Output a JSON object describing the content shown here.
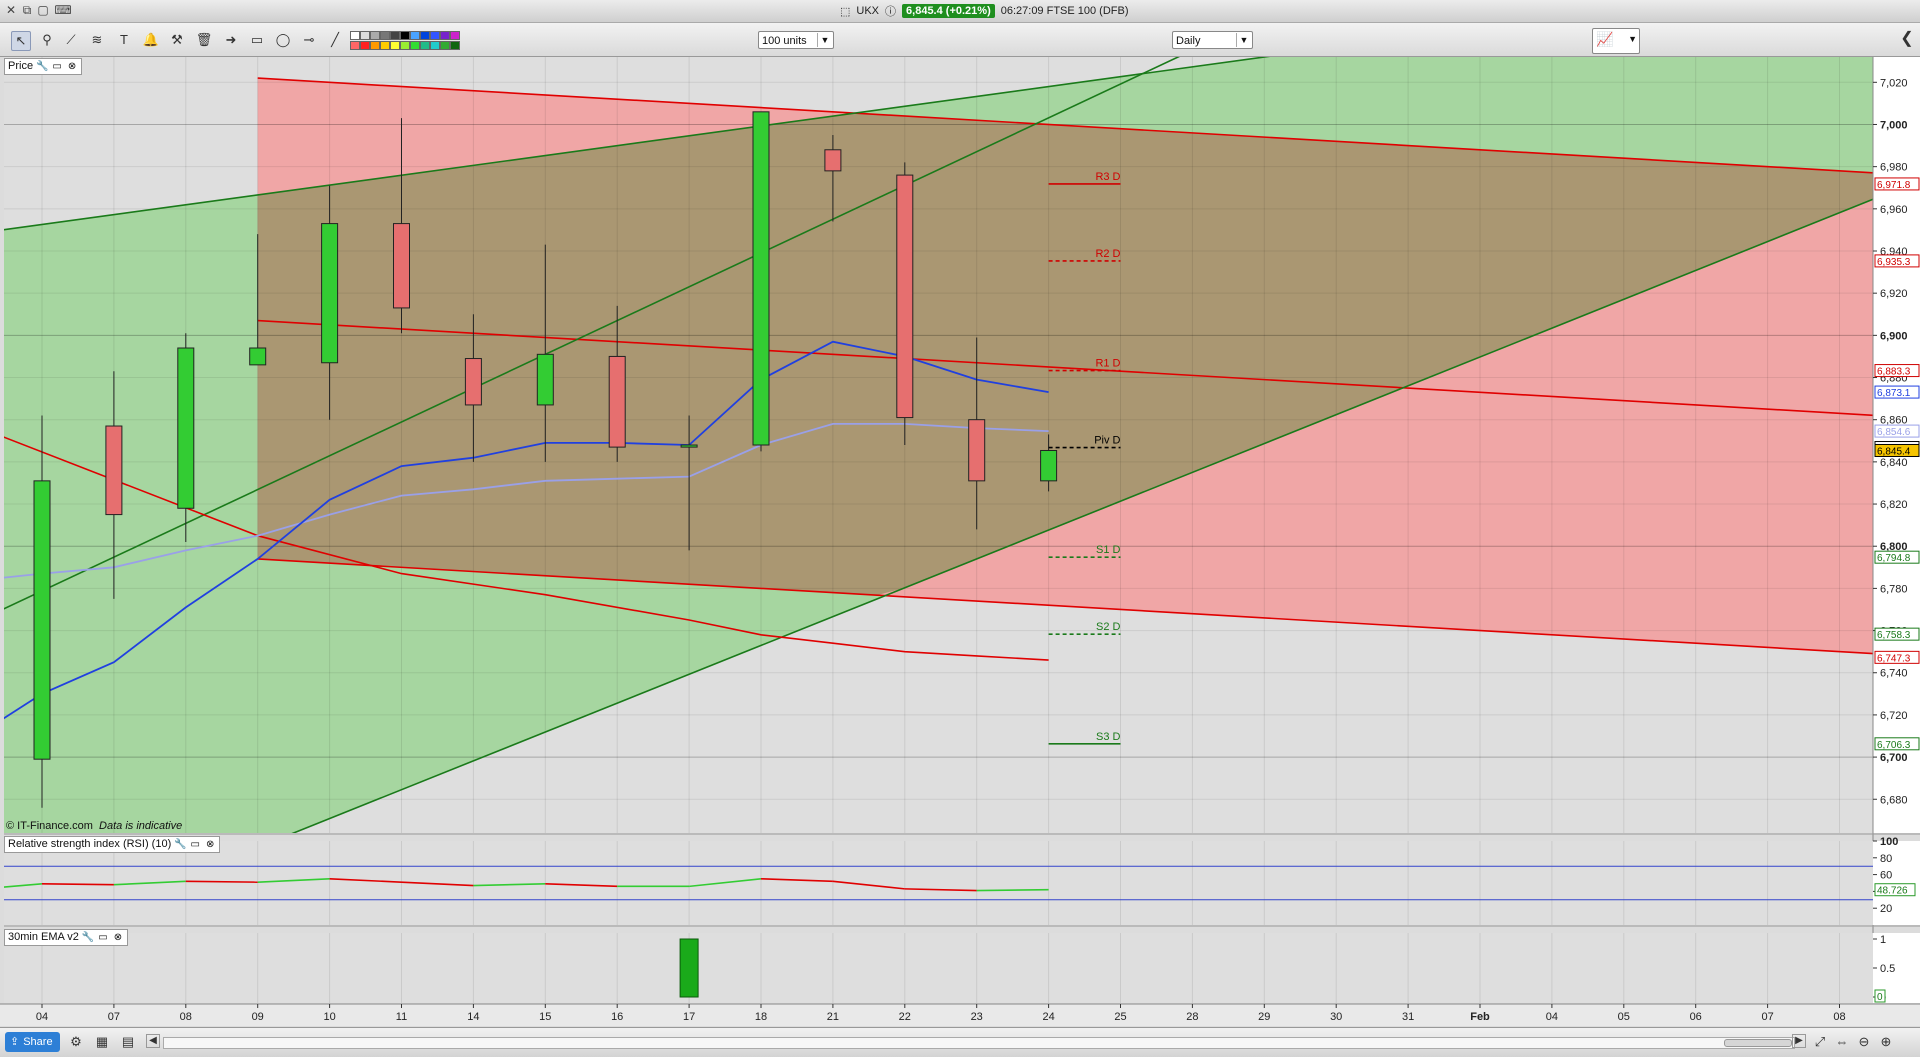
{
  "window": {
    "instrument": "UKX",
    "price_chip": "6,845.4 (+0.21%)",
    "status": "06:27:09 FTSE 100 (DFB)"
  },
  "toolbar": {
    "units_select": "100 units",
    "interval_select": "Daily"
  },
  "panels": {
    "price_label": "Price",
    "rsi_label": "Relative strength index (RSI) (10)",
    "ema_label": "30min EMA v2",
    "copyright": "© IT-Finance.com",
    "indicative": "Data is indicative"
  },
  "bottom": {
    "share_label": "Share"
  },
  "colors": {
    "up": "#33cc33",
    "down": "#e66f6f",
    "channel_red": "#e00000",
    "channel_green": "#1a7a1a",
    "ma_blue": "#2040e0",
    "ma_lavender": "#9aa0e8",
    "zone_green": "#a6d6a0",
    "zone_red": "#f0a6a6",
    "zone_brown": "#aa9772"
  },
  "chart_data": [
    {
      "type": "candlestick",
      "x_labels": [
        "04",
        "07",
        "08",
        "09",
        "10",
        "11",
        "14",
        "15",
        "16",
        "17",
        "18",
        "21",
        "22",
        "23",
        "24",
        "25",
        "28",
        "29",
        "30",
        "31",
        "Feb",
        "04",
        "05",
        "06",
        "07",
        "08"
      ],
      "y_ticks": [
        6680,
        6700,
        6720,
        6740,
        6760,
        6780,
        6800,
        6820,
        6840,
        6860,
        6880,
        6900,
        6920,
        6940,
        6960,
        6980,
        7000,
        7020
      ],
      "y_tick_labels": [
        "6,680",
        "6,700",
        "6,720",
        "6,740",
        "6,760",
        "6,780",
        "6,800",
        "6,820",
        "6,840",
        "6,860",
        "6,880",
        "6,900",
        "6,920",
        "6,940",
        "6,960",
        "6,980",
        "7,000",
        "7,020"
      ],
      "ylim": [
        6664,
        7032
      ],
      "candles": [
        {
          "x": 0,
          "o": 6699,
          "h": 6862,
          "l": 6676,
          "c": 6831
        },
        {
          "x": 1,
          "o": 6857,
          "h": 6883,
          "l": 6775,
          "c": 6815
        },
        {
          "x": 2,
          "o": 6818,
          "h": 6901,
          "l": 6802,
          "c": 6894
        },
        {
          "x": 3,
          "o": 6886,
          "h": 6948,
          "l": 6886,
          "c": 6894
        },
        {
          "x": 4,
          "o": 6887,
          "h": 6971,
          "l": 6860,
          "c": 6953
        },
        {
          "x": 5,
          "o": 6953,
          "h": 7003,
          "l": 6901,
          "c": 6913
        },
        {
          "x": 6,
          "o": 6889,
          "h": 6910,
          "l": 6840,
          "c": 6867
        },
        {
          "x": 7,
          "o": 6867,
          "h": 6943,
          "l": 6840,
          "c": 6891
        },
        {
          "x": 8,
          "o": 6890,
          "h": 6914,
          "l": 6840,
          "c": 6847
        },
        {
          "x": 9,
          "o": 6847,
          "h": 6862,
          "l": 6798,
          "c": 6848
        },
        {
          "x": 10,
          "o": 6848,
          "h": 7006,
          "l": 6845,
          "c": 7006
        },
        {
          "x": 11,
          "o": 6988,
          "h": 6995,
          "l": 6954,
          "c": 6978
        },
        {
          "x": 12,
          "o": 6976,
          "h": 6982,
          "l": 6848,
          "c": 6861
        },
        {
          "x": 13,
          "o": 6860,
          "h": 6899,
          "l": 6808,
          "c": 6831
        },
        {
          "x": 14,
          "o": 6831,
          "h": 6853,
          "l": 6826,
          "c": 6845.4
        }
      ],
      "ma_fast": [
        [
          -0.55,
          6718
        ],
        [
          0,
          6730
        ],
        [
          1,
          6745
        ],
        [
          2,
          6771
        ],
        [
          3,
          6794
        ],
        [
          4,
          6822
        ],
        [
          5,
          6838
        ],
        [
          6,
          6842
        ],
        [
          7,
          6849
        ],
        [
          8,
          6849
        ],
        [
          9,
          6848
        ],
        [
          10,
          6879
        ],
        [
          11,
          6897
        ],
        [
          12,
          6890
        ],
        [
          13,
          6879
        ],
        [
          14,
          6873.1
        ]
      ],
      "ma_slow": [
        [
          -0.55,
          6785
        ],
        [
          0,
          6787
        ],
        [
          1,
          6790
        ],
        [
          2,
          6798
        ],
        [
          3,
          6805
        ],
        [
          4,
          6815
        ],
        [
          5,
          6824
        ],
        [
          6,
          6827
        ],
        [
          7,
          6831
        ],
        [
          8,
          6832
        ],
        [
          9,
          6833
        ],
        [
          10,
          6848
        ],
        [
          11,
          6858
        ],
        [
          12,
          6858
        ],
        [
          13,
          6856
        ],
        [
          14,
          6854.6
        ]
      ],
      "ma_lower_red": [
        [
          -0.55,
          6852
        ],
        [
          3,
          6805
        ],
        [
          5,
          6787
        ],
        [
          7,
          6777
        ],
        [
          9,
          6765
        ],
        [
          10,
          6758
        ],
        [
          11,
          6754
        ],
        [
          12,
          6750
        ],
        [
          13,
          6748
        ],
        [
          14,
          6746
        ]
      ],
      "channel_red_upper": [
        [
          3,
          7022
        ],
        [
          25.5,
          6977
        ]
      ],
      "channel_red_middle": [
        [
          3,
          6907
        ],
        [
          25.5,
          6862
        ]
      ],
      "channel_red_lower": [
        [
          3,
          6794
        ],
        [
          25.5,
          6749
        ]
      ],
      "channel_green_upper": [
        [
          -0.55,
          6950
        ],
        [
          17.0,
          7032
        ]
      ],
      "channel_green_middle": [
        [
          -0.55,
          6770
        ],
        [
          15.8,
          7032
        ]
      ],
      "channel_green_lower": [
        [
          3.5,
          6664
        ],
        [
          25.5,
          6965
        ]
      ],
      "pivots": [
        {
          "label": "R3 D",
          "value": 6971.8,
          "value_label": "6,971.8",
          "style": "solid",
          "color": "#d00000"
        },
        {
          "label": "R2 D",
          "value": 6935.3,
          "value_label": "6,935.3",
          "style": "dashed",
          "color": "#d00000"
        },
        {
          "label": "R1 D",
          "value": 6883.3,
          "value_label": "6,883.3",
          "style": "dashed",
          "color": "#d00000"
        },
        {
          "label": "Piv D",
          "value": 6846.8,
          "value_label": "6,846.8",
          "style": "dashed",
          "color": "#000000"
        },
        {
          "label": "S1 D",
          "value": 6794.8,
          "value_label": "6,794.8",
          "style": "dashed",
          "color": "#1a7a1a"
        },
        {
          "label": "S2 D",
          "value": 6758.3,
          "value_label": "6,758.3",
          "style": "dashed",
          "color": "#1a7a1a"
        },
        {
          "label": "S3 D",
          "value": 6706.3,
          "value_label": "6,706.3",
          "style": "solid",
          "color": "#1a7a1a"
        }
      ],
      "right_labels": [
        {
          "value": 6873.1,
          "label": "6,873.1",
          "bg": "#ffffff",
          "fg": "#2040e0"
        },
        {
          "value": 6854.6,
          "label": "6,854.6",
          "bg": "#ffffff",
          "fg": "#9aa0e8"
        },
        {
          "value": 6845.4,
          "label": "6,845.4",
          "bg": "#f5c400",
          "fg": "#000000"
        },
        {
          "value": 6747.3,
          "label": "6,747.3",
          "bg": "#ffffff",
          "fg": "#d00000"
        }
      ]
    },
    {
      "type": "line",
      "title": "Relative strength index (RSI) (10)",
      "y_ticks": [
        20,
        40,
        60,
        80,
        100
      ],
      "ylim": [
        0,
        100
      ],
      "levels": [
        30,
        70
      ],
      "values": [
        [
          -0.55,
          45
        ],
        [
          0,
          49
        ],
        [
          1,
          48
        ],
        [
          2,
          52
        ],
        [
          3,
          51
        ],
        [
          4,
          55
        ],
        [
          5,
          51
        ],
        [
          6,
          47
        ],
        [
          7,
          49
        ],
        [
          8,
          46
        ],
        [
          9,
          46
        ],
        [
          10,
          55
        ],
        [
          11,
          52
        ],
        [
          12,
          43
        ],
        [
          13,
          41
        ],
        [
          14,
          42
        ]
      ],
      "last_label": "48.726"
    },
    {
      "type": "bar",
      "title": "30min EMA v2",
      "y_ticks": [
        0,
        0.5,
        1
      ],
      "y_tick_labels": [
        "0",
        "0.5",
        "1"
      ],
      "ylim": [
        0,
        1
      ],
      "bars": [
        {
          "x": 9,
          "value": 1
        }
      ],
      "last_label": "0"
    }
  ]
}
